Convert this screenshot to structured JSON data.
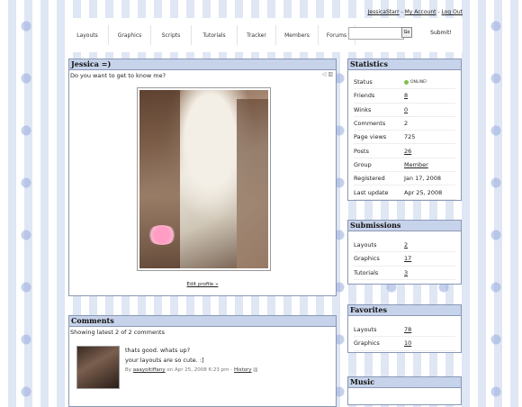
{
  "top_links": {
    "user": "JessicaStarr",
    "sep1": " - ",
    "account": "My Account",
    "sep2": " - ",
    "logout": "Log Out"
  },
  "nav": [
    "Layouts",
    "Graphics",
    "Scripts",
    "Tutorials",
    "Tracker",
    "Members",
    "Forums"
  ],
  "search": {
    "value": "",
    "go_label": "Go",
    "submit_label": "Submit!"
  },
  "profile": {
    "title": "Jessica =)",
    "subtitle": "Do you want to get to know me?",
    "edit_link": "Edit profile »"
  },
  "comments": {
    "title": "Comments",
    "summary": "Showing latest 2 of 2 comments",
    "items": [
      {
        "line1": "thats good. whats up?",
        "line2": "your layouts are so cute. :]",
        "by": "By",
        "author": "aaayoitiffany",
        "date": "on Apr 25, 2008 6:23 pm -",
        "history": "History"
      }
    ]
  },
  "statistics": {
    "title": "Statistics",
    "rows": [
      {
        "label": "Status",
        "value": "ONLINE!"
      },
      {
        "label": "Friends",
        "value": "8"
      },
      {
        "label": "Winks",
        "value": "0"
      },
      {
        "label": "Comments",
        "value": "2"
      },
      {
        "label": "Page views",
        "value": "725"
      },
      {
        "label": "Posts",
        "value": "26"
      },
      {
        "label": "Group",
        "value": "Member"
      },
      {
        "label": "Registered",
        "value": "Jan 17, 2008"
      },
      {
        "label": "Last update",
        "value": "Apr 25, 2008"
      }
    ]
  },
  "submissions": {
    "title": "Submissions",
    "rows": [
      {
        "label": "Layouts",
        "value": "2"
      },
      {
        "label": "Graphics",
        "value": "17"
      },
      {
        "label": "Tutorials",
        "value": "3"
      }
    ]
  },
  "favorites": {
    "title": "Favorites",
    "rows": [
      {
        "label": "Layouts",
        "value": "78"
      },
      {
        "label": "Graphics",
        "value": "10"
      }
    ]
  },
  "music": {
    "title": "Music"
  },
  "colors": {
    "panel_header": "#c7d3ea",
    "panel_border": "#8a98b5",
    "stripe": "#dfe6f4",
    "online_dot": "#7fbf4f"
  }
}
